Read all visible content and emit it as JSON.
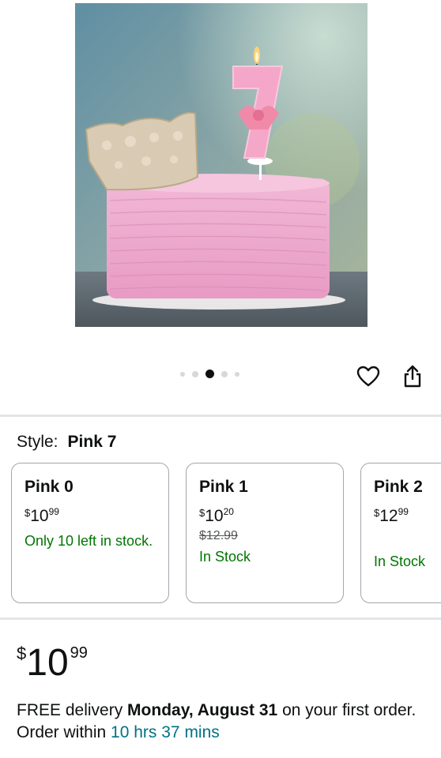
{
  "product": {
    "image": {
      "description_icon": "cake-photo"
    },
    "carousel": {
      "total": 5,
      "active_index": 2
    }
  },
  "actions": {
    "wishlist_icon": "heart-icon",
    "share_icon": "share-icon"
  },
  "style": {
    "label": "Style:",
    "value": "Pink 7"
  },
  "variants": [
    {
      "name": "Pink 0",
      "currency": "$",
      "price_whole": "10",
      "price_fraction": "99",
      "list_price": "",
      "stock": "Only 10 left in stock."
    },
    {
      "name": "Pink 1",
      "currency": "$",
      "price_whole": "10",
      "price_fraction": "20",
      "list_price": "$12.99",
      "stock": "In Stock"
    },
    {
      "name": "Pink 2",
      "currency": "$",
      "price_whole": "12",
      "price_fraction": "99",
      "list_price": "",
      "stock": "In Stock"
    }
  ],
  "price": {
    "currency": "$",
    "whole": "10",
    "fraction": "99"
  },
  "delivery": {
    "prefix": "FREE delivery ",
    "date": "Monday, August 31",
    "middle": " on your first order. Order within ",
    "countdown": "10 hrs 37 mins"
  },
  "colors": {
    "accent_green": "#007600",
    "link_teal": "#007185",
    "border": "#a2a6ac"
  }
}
